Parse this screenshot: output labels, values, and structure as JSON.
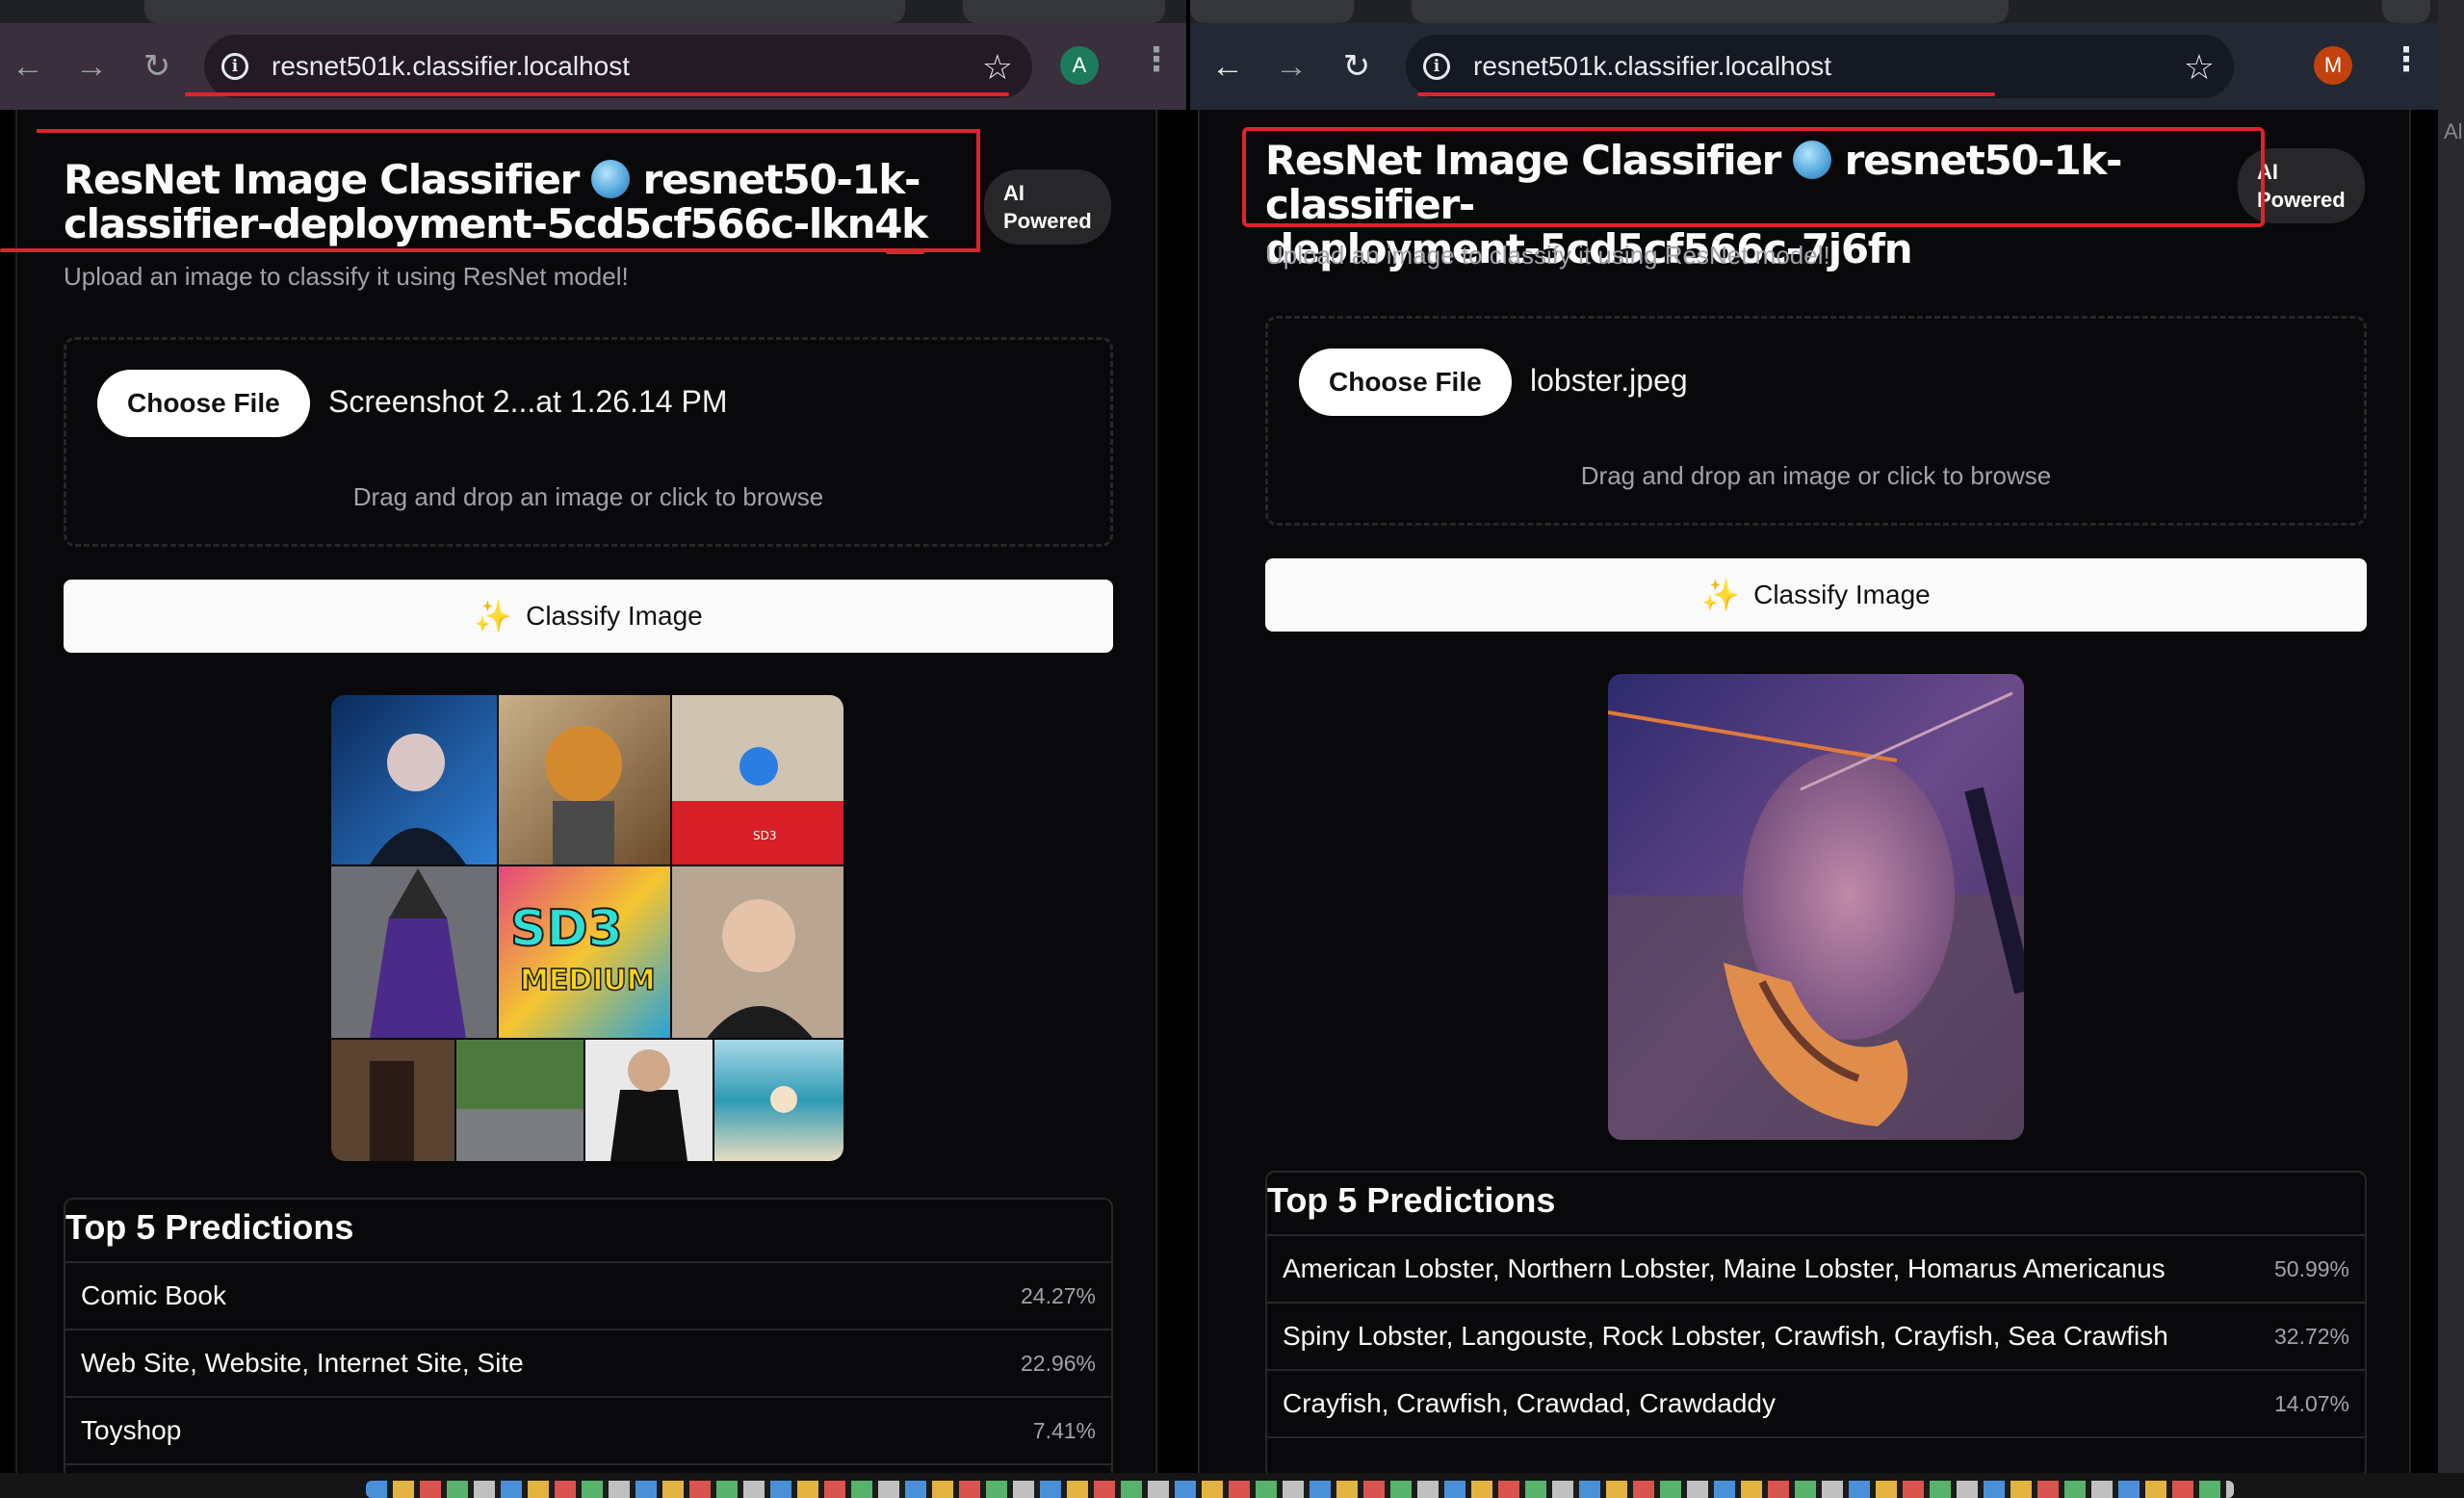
{
  "left": {
    "url": "resnet501k.classifier.localhost",
    "avatar_letter": "A",
    "avatar_color": "#1e7a5c",
    "title_line1": "ResNet Image Classifier",
    "title_after_globe": "resnet50-1k-",
    "title_line2": "classifier-deployment-5cd5cf566c-lkn4k",
    "badge_line1": "AI",
    "badge_line2": "Powered",
    "subtitle": "Upload an image to classify it using ResNet model!",
    "choose_file_label": "Choose File",
    "file_name": "Screenshot 2...at 1.26.14 PM",
    "drag_hint": "Drag and drop an image or click to browse",
    "classify_label": "Classify Image",
    "preview_alt": "collage of AI generated images",
    "preview_badge": "SD3",
    "graffiti_line1": "SD3",
    "graffiti_line2": "MEDIUM",
    "predictions_title": "Top 5 Predictions",
    "predictions": [
      {
        "label": "Comic Book",
        "score": "24.27%"
      },
      {
        "label": "Web Site, Website, Internet Site, Site",
        "score": "22.96%"
      },
      {
        "label": "Toyshop",
        "score": "7.41%"
      }
    ]
  },
  "right": {
    "url": "resnet501k.classifier.localhost",
    "avatar_letter": "M",
    "avatar_color": "#c2410c",
    "title_line1": "ResNet Image Classifier",
    "title_after_globe": "resnet50-1k-classifier-",
    "title_line2": "deployment-5cd5cf566c-7j6fn",
    "badge_line1": "AI",
    "badge_line2": "Powered",
    "subtitle": "Upload an image to classify it using ResNet model!",
    "choose_file_label": "Choose File",
    "file_name": "lobster.jpeg",
    "drag_hint": "Drag and drop an image or click to browse",
    "classify_label": "Classify Image",
    "preview_alt": "lobster in aquarium",
    "predictions_title": "Top 5 Predictions",
    "predictions": [
      {
        "label": "American Lobster, Northern Lobster, Maine Lobster, Homarus Americanus",
        "score": "50.99%"
      },
      {
        "label": "Spiny Lobster, Langouste, Rock Lobster, Crawfish, Crayfish, Sea Crawfish",
        "score": "32.72%"
      },
      {
        "label": "Crayfish, Crawfish, Crawdad, Crawdaddy",
        "score": "14.07%"
      }
    ]
  },
  "edge_text": "Al",
  "colors": {
    "annotation": "#e0222e",
    "button_bg": "#fafafa",
    "page_bg": "#09090b"
  }
}
